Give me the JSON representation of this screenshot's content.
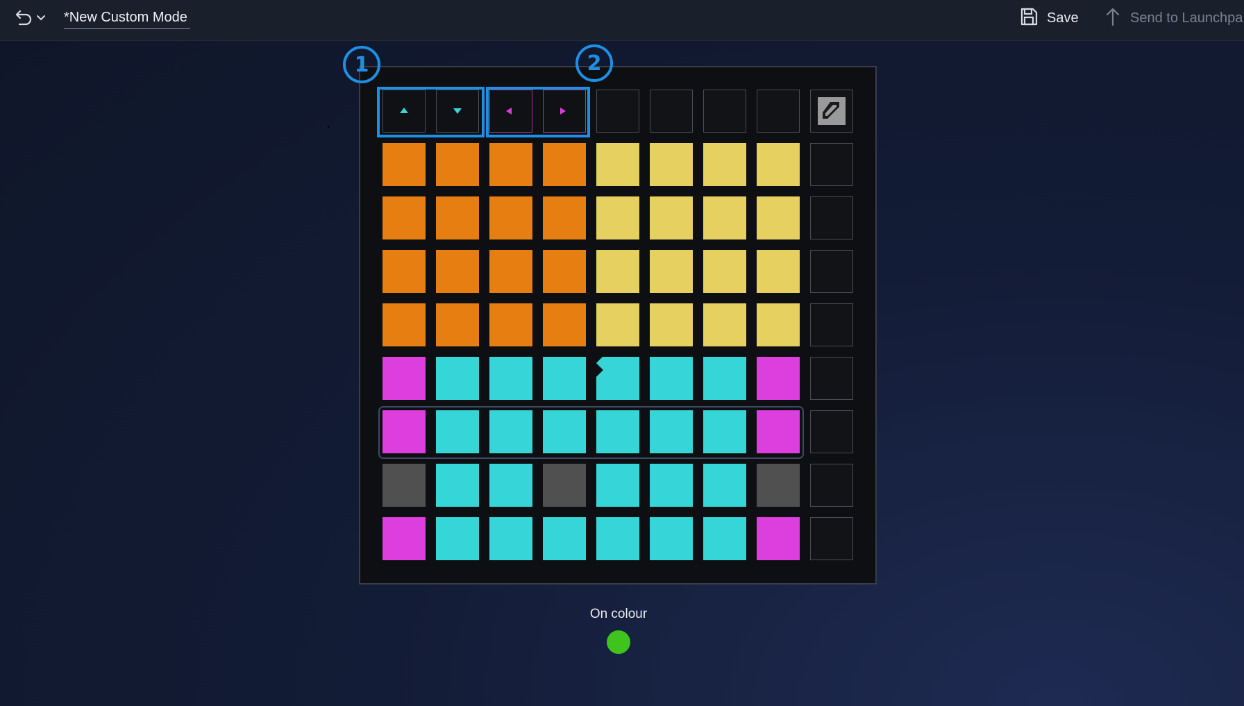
{
  "topbar": {
    "title": "*New Custom Mode",
    "save_label": "Save",
    "send_label": "Send to Launchpa",
    "icons": {
      "undo": "undo-icon",
      "dropdown": "chevron-down-icon",
      "save": "save-icon",
      "send": "upload-arrow-icon"
    }
  },
  "callouts": {
    "one": "1",
    "two": "2"
  },
  "colors": {
    "orange": "#e67e12",
    "yellow": "#e6d060",
    "cyan": "#36d6d8",
    "magenta": "#dd3ede",
    "gray": "#505050",
    "off": "#121316",
    "callout_blue": "#1e8fe3",
    "on_colour": "#3ec41c"
  },
  "top_row": [
    "up-arrow",
    "down-arrow",
    "left-arrow",
    "right-arrow",
    "off",
    "off",
    "off",
    "off"
  ],
  "grid": [
    [
      "orange",
      "orange",
      "orange",
      "orange",
      "yellow",
      "yellow",
      "yellow",
      "yellow"
    ],
    [
      "orange",
      "orange",
      "orange",
      "orange",
      "yellow",
      "yellow",
      "yellow",
      "yellow"
    ],
    [
      "orange",
      "orange",
      "orange",
      "orange",
      "yellow",
      "yellow",
      "yellow",
      "yellow"
    ],
    [
      "orange",
      "orange",
      "orange",
      "orange",
      "yellow",
      "yellow",
      "yellow",
      "yellow"
    ],
    [
      "magenta",
      "cyan",
      "cyan",
      "cyan",
      "cyan",
      "cyan",
      "cyan",
      "magenta"
    ],
    [
      "magenta",
      "cyan",
      "cyan",
      "cyan",
      "cyan",
      "cyan",
      "cyan",
      "magenta"
    ],
    [
      "gray",
      "cyan",
      "cyan",
      "gray",
      "cyan",
      "cyan",
      "cyan",
      "gray"
    ],
    [
      "magenta",
      "cyan",
      "cyan",
      "cyan",
      "cyan",
      "cyan",
      "cyan",
      "magenta"
    ]
  ],
  "side_column": [
    "off",
    "off",
    "off",
    "off",
    "off",
    "off",
    "off",
    "off"
  ],
  "logo": "launchpad-logo-icon",
  "on_colour": {
    "label": "On colour",
    "color": "#3ec41c"
  }
}
